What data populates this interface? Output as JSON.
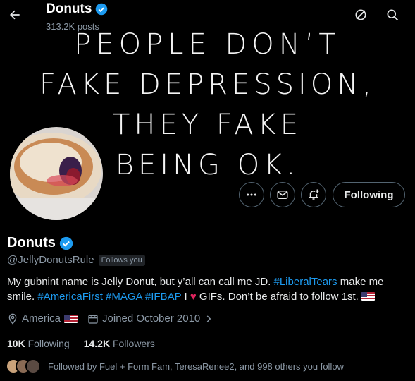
{
  "banner": {
    "lines": [
      "PEOPLE DON’T",
      "FAKE DEPRESSION,",
      "THEY FAKE",
      "BEING OK."
    ]
  },
  "topbar": {
    "title": "Donuts",
    "post_count": "313.2K posts",
    "back_icon": "arrow-left-icon",
    "grok_icon": "grok-icon",
    "search_icon": "search-icon"
  },
  "actions": {
    "more_icon": "more-icon",
    "message_icon": "message-icon",
    "notify_icon": "bell-plus-icon",
    "follow_label": "Following"
  },
  "profile": {
    "name": "Donuts",
    "handle": "@JellyDonutsRule",
    "follows_you": "Follows you",
    "bio": {
      "t1": "My gubnint name is Jelly Donut, but y’all can call me JD. ",
      "tag1": "#LiberalTears",
      "t2": " make me smile. ",
      "tag2": "#AmericaFirst",
      "tag3": "#MAGA",
      "tag4": "#IFBAP",
      "t3": " I ",
      "t4": " GIFs. Don’t be afraid to follow 1st. "
    },
    "location": "America",
    "joined": "Joined October 2010",
    "following_count": "10K",
    "following_label": "Following",
    "followers_count": "14.2K",
    "followers_label": "Followers",
    "followed_by": "Followed by Fuel + Form Fam, TeresaRenee2, and 998 others you follow"
  },
  "colors": {
    "accent": "#1d9bf0",
    "verified": "#1d9bf0",
    "muted": "#8b98a5",
    "border": "#536471"
  }
}
